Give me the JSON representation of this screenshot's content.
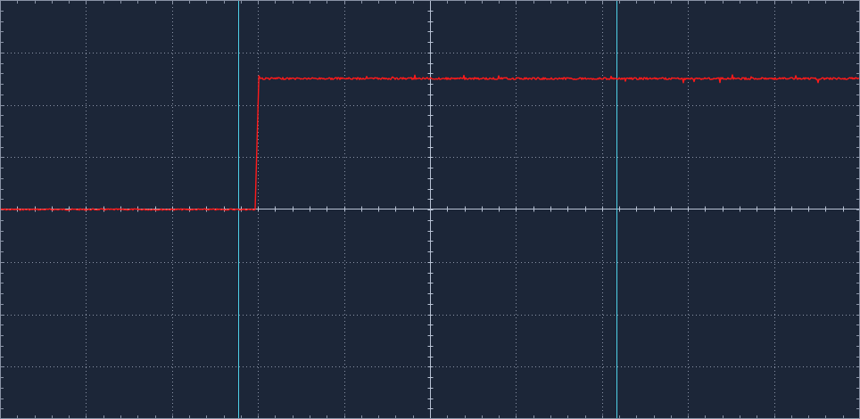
{
  "display": {
    "background_color": "#1c2638",
    "grid_color": "#8a93a6",
    "axis_color": "#b8c2d4",
    "cursor_color": "#4fd0e8",
    "trace_color": "#ff1a1a",
    "grid_divisions_x": 10,
    "grid_divisions_y": 8,
    "minor_ticks_per_division": 5
  },
  "chart_data": {
    "type": "line",
    "title": "",
    "xlabel": "",
    "ylabel": "",
    "xlim": [
      0,
      10
    ],
    "ylim": [
      -4,
      4
    ],
    "grid": true,
    "series": [
      {
        "values_description_points": [
          [
            0.0,
            0.0
          ],
          [
            2.97,
            0.0
          ],
          [
            3.02,
            2.5
          ],
          [
            10.0,
            2.5
          ]
        ]
      }
    ],
    "step_edge_div": 3.0,
    "low_level_div": 0.0,
    "high_level_div": 2.5
  },
  "cursors": {
    "vertical": [
      {
        "position_div": 2.77
      },
      {
        "position_div": 7.17
      }
    ]
  }
}
